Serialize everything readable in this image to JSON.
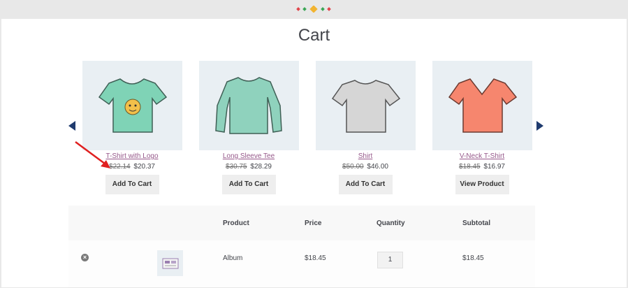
{
  "page": {
    "title": "Cart"
  },
  "colors": {
    "accent": "#96588a",
    "nav_arrow": "#1f3b6e",
    "annotation_arrow": "#e02020",
    "thumb_bg": "#e9eff3"
  },
  "cross_sells": [
    {
      "name": "T-Shirt with Logo",
      "old_price": "$22.14",
      "price": "$20.37",
      "button": "Add To Cart",
      "image": "tshirt-with-logo-icon",
      "shirt_color": "#7fd3b6"
    },
    {
      "name": "Long Sleeve Tee",
      "old_price": "$30.75",
      "price": "$28.29",
      "button": "Add To Cart",
      "image": "long-sleeve-tee-icon",
      "shirt_color": "#8fd2bd"
    },
    {
      "name": "Shirt",
      "old_price": "$50.00",
      "price": "$46.00",
      "button": "Add To Cart",
      "image": "shirt-icon",
      "shirt_color": "#d6d6d6"
    },
    {
      "name": "V-Neck T-Shirt",
      "old_price": "$18.45",
      "price": "$16.97",
      "button": "View Product",
      "image": "vneck-tshirt-icon",
      "shirt_color": "#f6866e"
    }
  ],
  "table": {
    "headers": {
      "product": "Product",
      "price": "Price",
      "quantity": "Quantity",
      "subtotal": "Subtotal"
    },
    "rows": [
      {
        "remove": "×",
        "product": "Album",
        "price": "$18.45",
        "quantity": "1",
        "subtotal": "$18.45"
      }
    ]
  }
}
